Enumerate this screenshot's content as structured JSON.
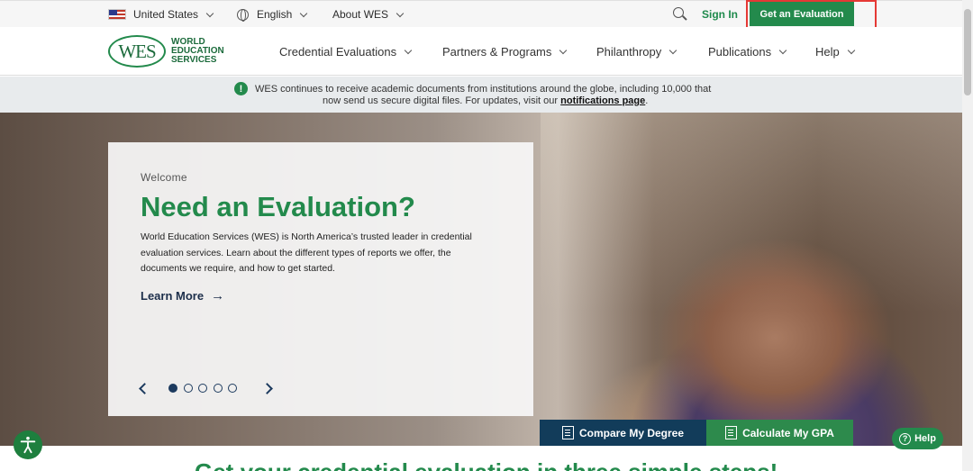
{
  "utility": {
    "country": "United States",
    "language": "English",
    "about": "About WES",
    "sign_in": "Sign In",
    "get_evaluation": "Get an Evaluation"
  },
  "logo": {
    "mark": "WES",
    "line1": "WORLD",
    "line2": "EDUCATION",
    "line3": "SERVICES"
  },
  "nav": [
    {
      "label": "Credential Evaluations"
    },
    {
      "label": "Partners & Programs"
    },
    {
      "label": "Philanthropy"
    },
    {
      "label": "Publications"
    },
    {
      "label": "Help"
    }
  ],
  "notice": {
    "line1": "WES continues to receive academic documents from institutions around the globe, including 10,000 that",
    "line2_prefix": "now send us secure digital files. For updates, visit our ",
    "link": "notifications page",
    "line2_suffix": "."
  },
  "hero": {
    "welcome": "Welcome",
    "title": "Need an Evaluation?",
    "description": "World Education Services (WES) is North America’s trusted leader in credential evaluation services. Learn about the different types of reports we offer, the documents we require, and how to get started.",
    "link": "Learn More",
    "slides": 5,
    "active_slide": 1
  },
  "actions": {
    "compare": "Compare My Degree",
    "gpa": "Calculate My GPA"
  },
  "help_label": "Help",
  "teaser": "Get your credential evaluation in three simple steps!",
  "colors": {
    "brand_green": "#238a4c",
    "navy": "#123c5a"
  }
}
